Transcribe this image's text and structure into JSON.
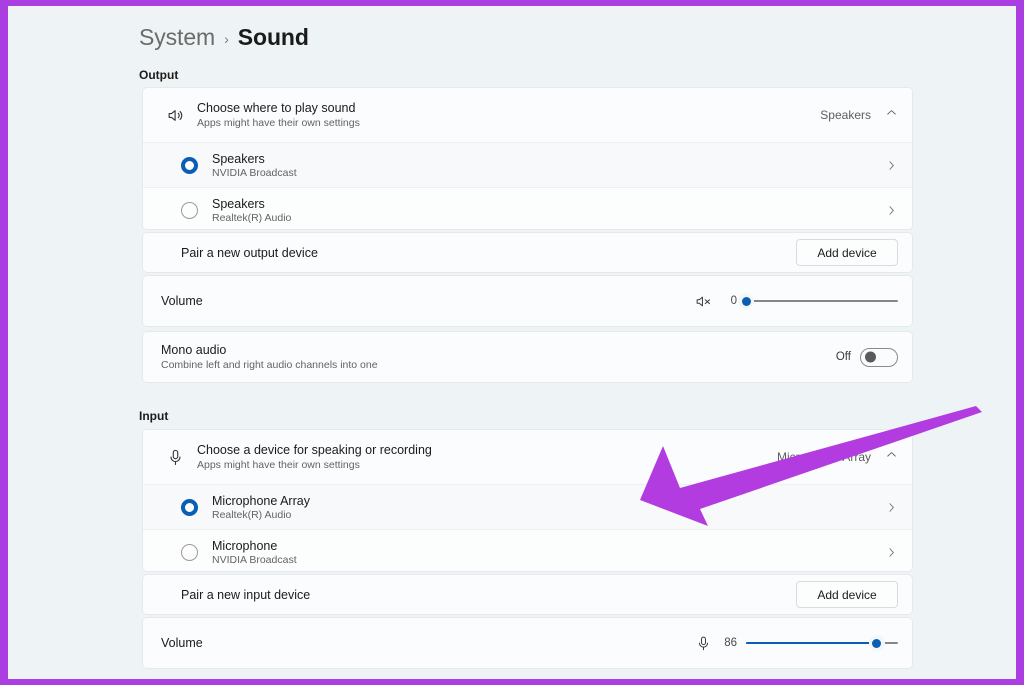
{
  "breadcrumb": {
    "parent": "System",
    "separator": "›",
    "current": "Sound"
  },
  "sections": {
    "output_label": "Output",
    "input_label": "Input"
  },
  "output": {
    "header": {
      "icon": "speaker-icon",
      "title": "Choose where to play sound",
      "subtitle": "Apps might have their own settings",
      "value": "Speakers",
      "chevron": "chevron-up-icon"
    },
    "devices": [
      {
        "name": "Speakers",
        "driver": "NVIDIA Broadcast",
        "selected": true
      },
      {
        "name": "Speakers",
        "driver": "Realtek(R) Audio",
        "selected": false
      }
    ],
    "pair": {
      "label": "Pair a new output device",
      "button": "Add device"
    },
    "volume": {
      "label": "Volume",
      "icon": "speaker-muted-icon",
      "value": "0",
      "percent": 0
    }
  },
  "mono_audio": {
    "title": "Mono audio",
    "subtitle": "Combine left and right audio channels into one",
    "state_label": "Off",
    "enabled": false
  },
  "input": {
    "header": {
      "icon": "microphone-icon",
      "title": "Choose a device for speaking or recording",
      "subtitle": "Apps might have their own settings",
      "value": "Microphone Array",
      "chevron": "chevron-up-icon"
    },
    "devices": [
      {
        "name": "Microphone Array",
        "driver": "Realtek(R) Audio",
        "selected": true
      },
      {
        "name": "Microphone",
        "driver": "NVIDIA Broadcast",
        "selected": false
      }
    ],
    "pair": {
      "label": "Pair a new input device",
      "button": "Add device"
    },
    "volume": {
      "label": "Volume",
      "icon": "microphone-icon",
      "value": "86",
      "percent": 86
    }
  },
  "annotation": {
    "type": "arrow",
    "color": "#b23ce0",
    "points_to": "input-device-row-microphone-array"
  },
  "colors": {
    "accent": "#0a5eb4",
    "annotation_purple": "#aa3ee0",
    "page_background": "#eef4f5",
    "card_background": "#fbfcfd"
  }
}
